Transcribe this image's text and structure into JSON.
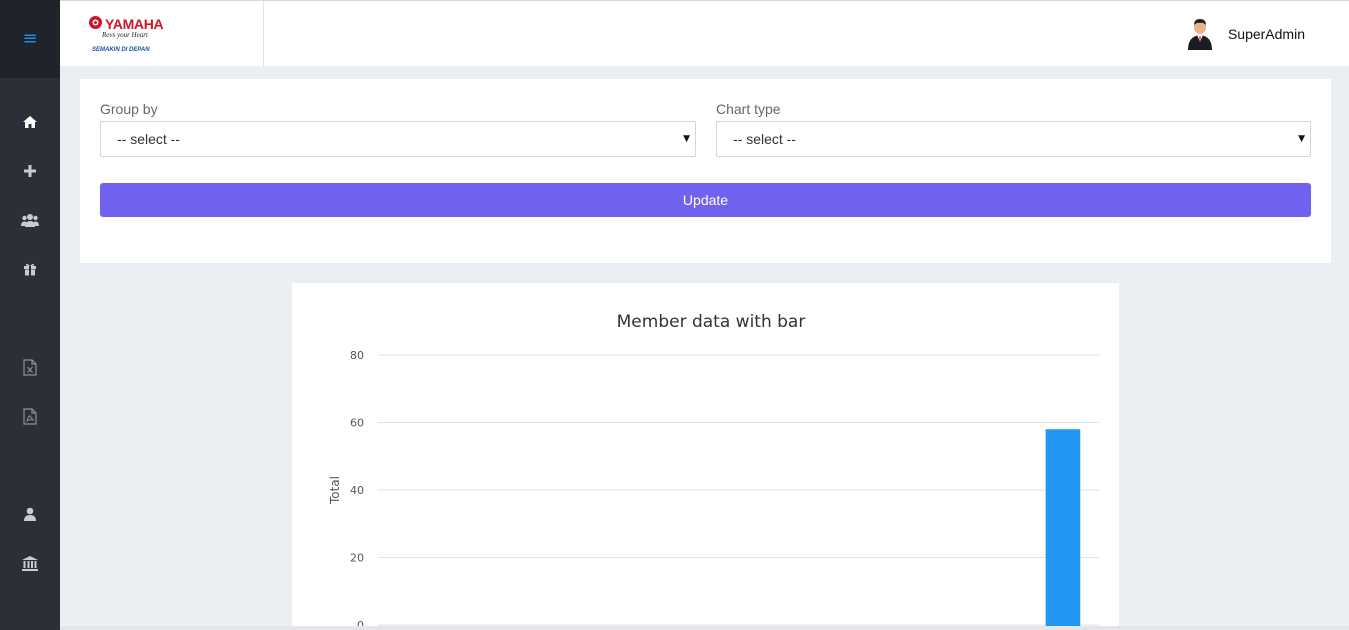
{
  "sidebar": {
    "menu_icon": "hamburger-menu-icon",
    "items": [
      {
        "icon": "home-icon"
      },
      {
        "icon": "plus-icon"
      },
      {
        "icon": "users-icon"
      },
      {
        "icon": "gift-icon"
      },
      {
        "icon": "excel-file-icon"
      },
      {
        "icon": "pdf-file-icon"
      },
      {
        "icon": "user-icon"
      },
      {
        "icon": "bank-icon"
      }
    ],
    "colors": {
      "background": "#2a2f38",
      "top": "#1f232a",
      "icon": "#c9ccd1",
      "menu_icon": "#1e90e6"
    }
  },
  "header": {
    "logo": {
      "brand": "YAMAHA",
      "tagline": "Revs your Heart",
      "sub": "SEMAKIN DI DEPAN"
    },
    "user": {
      "name": "SuperAdmin",
      "avatar": "user-avatar"
    }
  },
  "filters": {
    "group_by": {
      "label": "Group by",
      "value": "-- select --"
    },
    "chart_type": {
      "label": "Chart type",
      "value": "-- select --"
    },
    "update_label": "Update",
    "accent": "#7161ef"
  },
  "chart_data": {
    "type": "bar",
    "title": "Member data with bar",
    "xlabel": "",
    "ylabel": "Total",
    "ylim": [
      0,
      80
    ],
    "yticks": [
      0,
      20,
      40,
      60,
      80
    ],
    "categories": [
      "",
      "",
      "",
      "",
      "",
      "",
      "",
      "",
      "",
      ""
    ],
    "values": [
      0,
      0,
      0,
      0,
      0,
      0,
      0,
      0,
      0,
      58
    ],
    "bar_color": "#2196f3",
    "grid": true
  }
}
